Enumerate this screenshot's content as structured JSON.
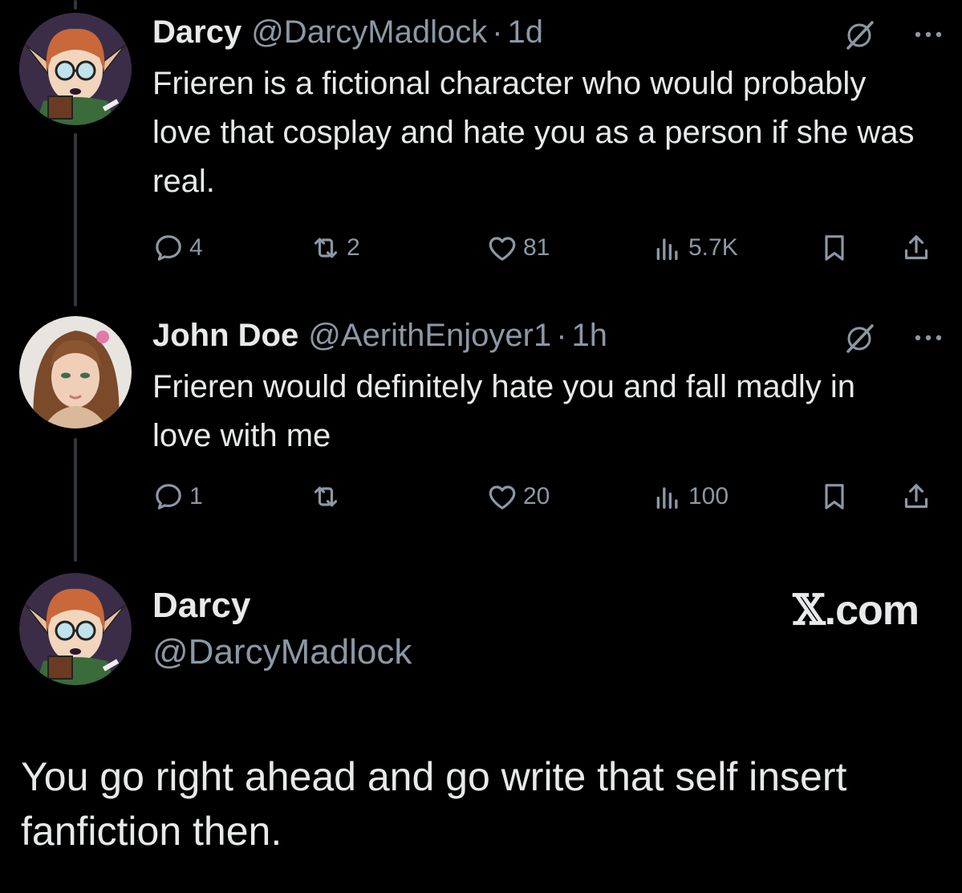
{
  "posts": [
    {
      "name": "Darcy",
      "handle": "@DarcyMadlock",
      "separator": "·",
      "time": "1d",
      "text": "Frieren is a fictional character who would probably love that cosplay and hate you as a person if she was real.",
      "replies": "4",
      "reposts": "2",
      "likes": "81",
      "views": "5.7K"
    },
    {
      "name": "John Doe",
      "handle": "@AerithEnjoyer1",
      "separator": "·",
      "time": "1h",
      "text": "Frieren would definitely hate you and fall madly in love with me",
      "replies": "1",
      "reposts": "",
      "likes": "20",
      "views": "100"
    }
  ],
  "quote": {
    "name": "Darcy",
    "handle": "@DarcyMadlock",
    "brand_mark": "𝕏",
    "brand_suffix": ".com",
    "text": "You go right ahead and go write that self insert fanfiction then."
  },
  "icons": {
    "reply": "reply-icon",
    "repost": "repost-icon",
    "like": "heart-icon",
    "views": "views-icon",
    "bookmark": "bookmark-icon",
    "share": "share-icon",
    "grok": "grok-icon",
    "more": "more-icon"
  },
  "colors": {
    "background": "#000000",
    "text": "#e7e9ea",
    "secondary": "#8b98a5",
    "thread_line": "#333639"
  }
}
